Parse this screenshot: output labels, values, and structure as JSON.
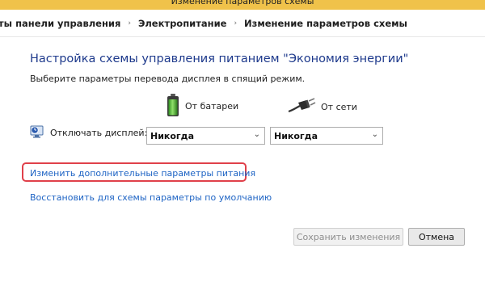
{
  "window": {
    "title": "Изменение параметров схемы"
  },
  "breadcrumb": {
    "items": [
      "ты панели управления",
      "Электропитание",
      "Изменение параметров схемы"
    ],
    "separator": "›"
  },
  "page": {
    "heading": "Настройка схемы управления питанием \"Экономия энергии\"",
    "subheading": "Выберите параметры перевода дисплея в спящий режим."
  },
  "columns": {
    "battery": "От батареи",
    "plugged": "От сети"
  },
  "settings": {
    "display_off": {
      "label": "Отключать дисплей:",
      "battery_value": "Никогда",
      "plugged_value": "Никогда"
    }
  },
  "links": {
    "advanced": "Изменить дополнительные параметры питания",
    "restore": "Восстановить для схемы параметры по умолчанию"
  },
  "buttons": {
    "save": "Сохранить изменения",
    "cancel": "Отмена"
  },
  "colors": {
    "heading": "#1e3a8c",
    "link": "#1d63c4",
    "highlight_box": "#e0404a",
    "titlebar": "#f0c24a"
  },
  "icons": {
    "battery": "battery-icon",
    "plug": "power-plug-icon",
    "display_timer": "display-timer-icon",
    "chevron": "chevron-down-icon"
  }
}
